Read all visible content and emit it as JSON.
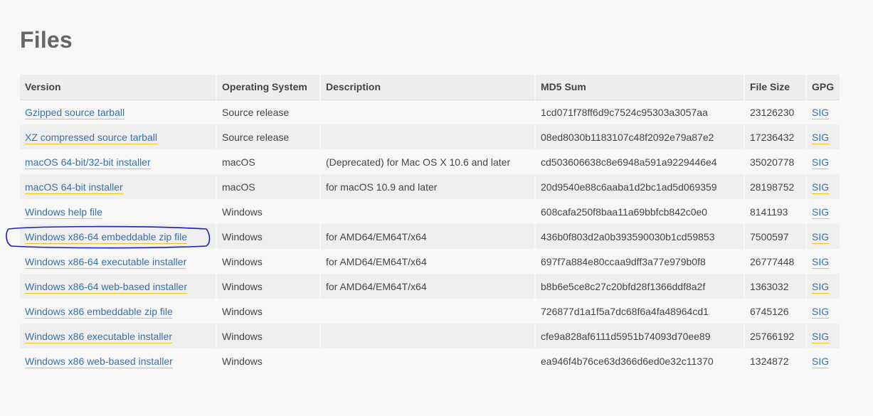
{
  "page": {
    "title": "Files"
  },
  "files_table": {
    "headers": {
      "version": "Version",
      "os": "Operating System",
      "description": "Description",
      "md5": "MD5 Sum",
      "size": "File Size",
      "gpg": "GPG"
    },
    "rows": [
      {
        "version": "Gzipped source tarball",
        "os": "Source release",
        "description": "",
        "md5": "1cd071f78ff6d9c7524c95303a3057aa",
        "size": "23126230",
        "gpg": "SIG"
      },
      {
        "version": "XZ compressed source tarball",
        "os": "Source release",
        "description": "",
        "md5": "08ed8030b1183107c48f2092e79a87e2",
        "size": "17236432",
        "gpg": "SIG"
      },
      {
        "version": "macOS 64-bit/32-bit installer",
        "os": "macOS",
        "description": "(Deprecated) for Mac OS X 10.6 and later",
        "md5": "cd503606638c8e6948a591a9229446e4",
        "size": "35020778",
        "gpg": "SIG"
      },
      {
        "version": "macOS 64-bit installer",
        "os": "macOS",
        "description": "for macOS 10.9 and later",
        "md5": "20d9540e88c6aaba1d2bc1ad5d069359",
        "size": "28198752",
        "gpg": "SIG"
      },
      {
        "version": "Windows help file",
        "os": "Windows",
        "description": "",
        "md5": "608cafa250f8baa11a69bbfcb842c0e0",
        "size": "8141193",
        "gpg": "SIG"
      },
      {
        "version": "Windows x86-64 embeddable zip file",
        "os": "Windows",
        "description": "for AMD64/EM64T/x64",
        "md5": "436b0f803d2a0b393590030b1cd59853",
        "size": "7500597",
        "gpg": "SIG"
      },
      {
        "version": "Windows x86-64 executable installer",
        "os": "Windows",
        "description": "for AMD64/EM64T/x64",
        "md5": "697f7a884e80ccaa9dff3a77e979b0f8",
        "size": "26777448",
        "gpg": "SIG"
      },
      {
        "version": "Windows x86-64 web-based installer",
        "os": "Windows",
        "description": "for AMD64/EM64T/x64",
        "md5": "b8b6e5ce8c27c20bfd28f1366ddf8a2f",
        "size": "1363032",
        "gpg": "SIG"
      },
      {
        "version": "Windows x86 embeddable zip file",
        "os": "Windows",
        "description": "",
        "md5": "726877d1a1f5a7dc68f6a4fa48964cd1",
        "size": "6745126",
        "gpg": "SIG"
      },
      {
        "version": "Windows x86 executable installer",
        "os": "Windows",
        "description": "",
        "md5": "cfe9a828af6111d5951b74093d70ee89",
        "size": "25766192",
        "gpg": "SIG"
      },
      {
        "version": "Windows x86 web-based installer",
        "os": "Windows",
        "description": "",
        "md5": "ea946f4b76ce63d366d6ed0e32c11370",
        "size": "1324872",
        "gpg": "SIG"
      }
    ]
  },
  "colors": {
    "link": "#3a6fa8",
    "link_underline": "#f0c420",
    "highlight_circle": "#1f1fb4"
  }
}
